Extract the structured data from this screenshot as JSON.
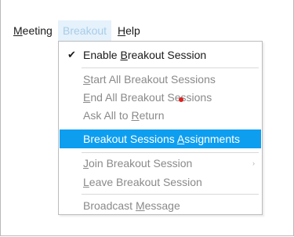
{
  "menubar": {
    "items": [
      {
        "label_prefix": "",
        "label_underlined": "M",
        "label_rest": "eeting"
      },
      {
        "label": "Breakout"
      },
      {
        "label_prefix": "",
        "label_underlined": "H",
        "label_rest": "elp"
      }
    ]
  },
  "breakout_menu": {
    "items": [
      {
        "pre": "Enable ",
        "u": "B",
        "post": "reakout Session",
        "state": "enabled",
        "checked": true
      },
      {
        "pre": "",
        "u": "S",
        "post": "tart All Breakout Sessions",
        "state": "disabled"
      },
      {
        "pre": "",
        "u": "E",
        "post": "nd All Breakout Sessions",
        "state": "disabled"
      },
      {
        "pre": "Ask All to ",
        "u": "R",
        "post": "eturn",
        "state": "disabled"
      },
      {
        "pre": "Breakout Sessions ",
        "u": "A",
        "post": "ssignments",
        "state": "selected"
      },
      {
        "pre": "",
        "u": "J",
        "post": "oin Breakout Session",
        "state": "disabled",
        "submenu": true
      },
      {
        "pre": "",
        "u": "L",
        "post": "eave Breakout Session",
        "state": "disabled"
      },
      {
        "pre": "Broadcast ",
        "u": "M",
        "post": "essage",
        "state": "disabled"
      }
    ],
    "checkmark_glyph": "✔",
    "submenu_glyph": "›"
  },
  "colors": {
    "selection_bg": "#0d9ef0",
    "active_menu_bg": "#e5f1fb",
    "disabled_text": "#8a8a8a",
    "cursor_dot": "#e02020"
  }
}
